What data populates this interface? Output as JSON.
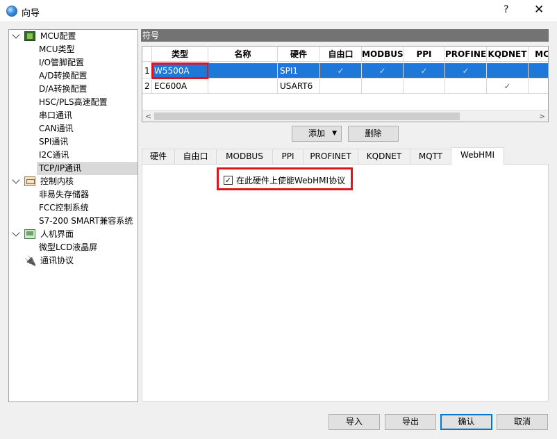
{
  "window": {
    "title": "向导",
    "help": "?",
    "close": "✕"
  },
  "tree": {
    "items": [
      {
        "label": "MCU配置",
        "level": 0,
        "icon": "mcu-chip-icon",
        "expanded": true
      },
      {
        "label": "MCU类型",
        "level": 1
      },
      {
        "label": "I/O管脚配置",
        "level": 1
      },
      {
        "label": "A/D转换配置",
        "level": 1
      },
      {
        "label": "D/A转换配置",
        "level": 1
      },
      {
        "label": "HSC/PLS高速配置",
        "level": 1
      },
      {
        "label": "串口通讯",
        "level": 1
      },
      {
        "label": "CAN通讯",
        "level": 1
      },
      {
        "label": "SPI通讯",
        "level": 1
      },
      {
        "label": "I2C通讯",
        "level": 1
      },
      {
        "label": "TCP/IP通讯",
        "level": 1,
        "selected": true
      },
      {
        "label": "控制内核",
        "level": 0,
        "icon": "control-core-icon",
        "expanded": true
      },
      {
        "label": "非易失存储器",
        "level": 1
      },
      {
        "label": "FCC控制系统",
        "level": 1
      },
      {
        "label": "S7-200 SMART兼容系统",
        "level": 1
      },
      {
        "label": "人机界面",
        "level": 0,
        "icon": "hmi-screen-icon",
        "expanded": true
      },
      {
        "label": "微型LCD液晶屏",
        "level": 1
      },
      {
        "label": "通讯协议",
        "level": 0,
        "icon": "plug-icon"
      }
    ]
  },
  "symbol_panel": {
    "header": "符号",
    "columns": [
      "类型",
      "名称",
      "硬件",
      "自由口",
      "MODBUS",
      "PPI",
      "PROFINET",
      "KQDNET",
      "MC"
    ],
    "rows": [
      {
        "num": "1",
        "type": "W5500A",
        "name": "",
        "hw": "SPI1",
        "checks": [
          true,
          true,
          true,
          true,
          false,
          false
        ],
        "selected": true
      },
      {
        "num": "2",
        "type": "EC600A",
        "name": "",
        "hw": "USART6",
        "checks": [
          false,
          false,
          false,
          false,
          true,
          false
        ],
        "selected": false
      }
    ],
    "check_glyph": "✓",
    "scroll_left": "<",
    "scroll_right": ">"
  },
  "buttons": {
    "add": "添加",
    "add_arrow": "▼",
    "delete": "删除"
  },
  "tabs": [
    {
      "label": "硬件"
    },
    {
      "label": "自由口"
    },
    {
      "label": "MODBUS"
    },
    {
      "label": "PPI"
    },
    {
      "label": "PROFINET"
    },
    {
      "label": "KQDNET"
    },
    {
      "label": "MQTT"
    },
    {
      "label": "WebHMI",
      "active": true
    }
  ],
  "webhmi": {
    "enable_label": "在此硬件上使能WebHMI协议",
    "enabled": true,
    "check_mark": "✓"
  },
  "footer": {
    "import": "导入",
    "export": "导出",
    "ok": "确认",
    "cancel": "取消"
  },
  "colors": {
    "selection": "#1e78d7",
    "highlight": "#e0141e",
    "header_bar": "#737373",
    "focus": "#0078d7"
  }
}
